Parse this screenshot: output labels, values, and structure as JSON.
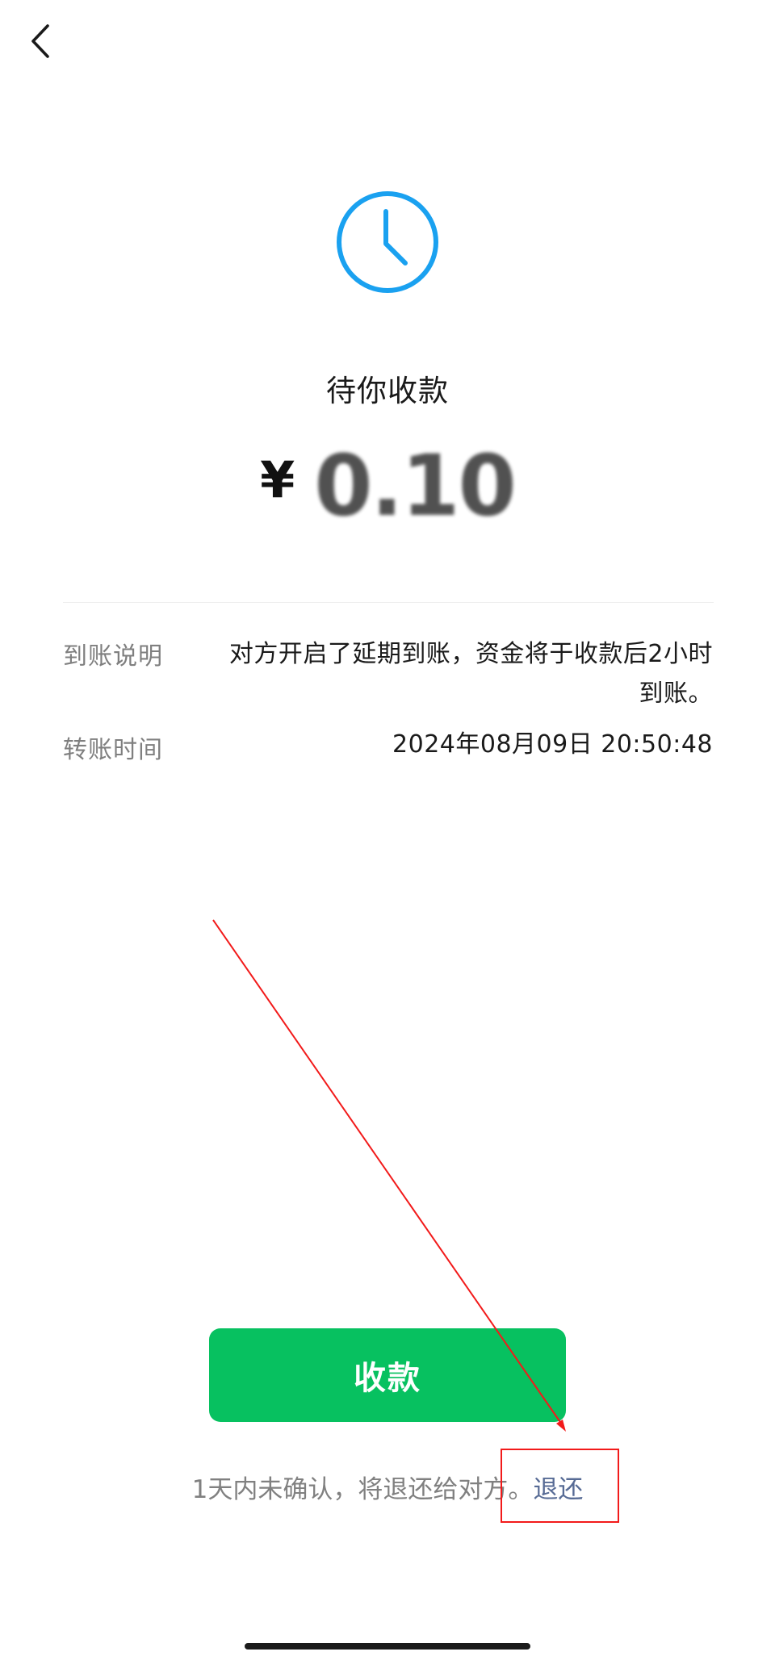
{
  "header": {
    "back_icon": "chevron-left-icon"
  },
  "status": {
    "icon": "clock-icon",
    "icon_color": "#1aa1f0",
    "title": "待你收款"
  },
  "amount": {
    "currency": "¥",
    "value": "0.10"
  },
  "details": {
    "arrival": {
      "label": "到账说明",
      "value": "对方开启了延期到账，资金将于收款后2小时到账。"
    },
    "time": {
      "label": "转账时间",
      "value": "2024年08月09日 20:50:48"
    }
  },
  "actions": {
    "receive_label": "收款",
    "receive_color": "#07c160"
  },
  "notice": {
    "text": "1天内未确认，将退还给对方。",
    "return_link": "退还",
    "link_color": "#576b95"
  },
  "annotation": {
    "color": "#f21a1a"
  }
}
